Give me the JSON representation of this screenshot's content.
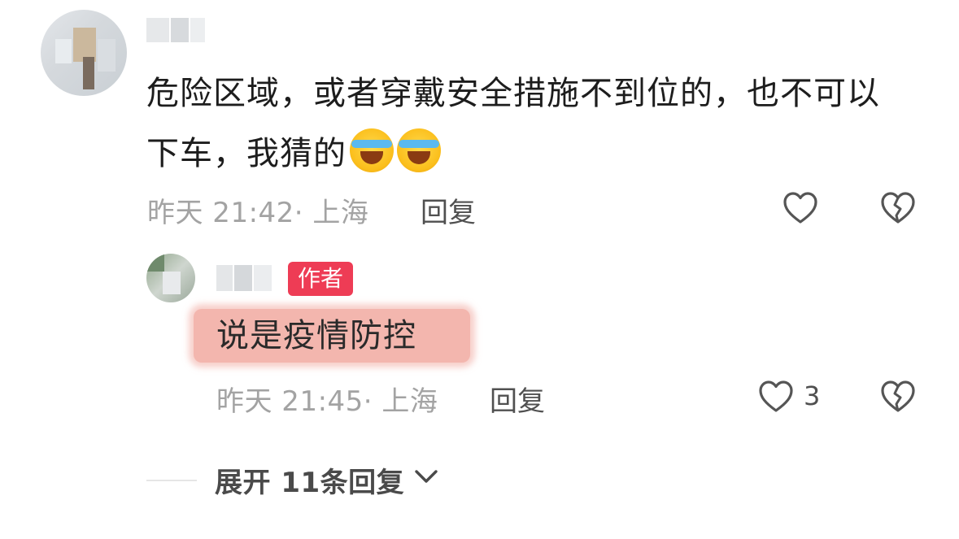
{
  "comment": {
    "text": "危险区域，或者穿戴安全措施不到位的，也不可以下车，我猜的",
    "emojis": [
      "laughing-crying-emoji",
      "laughing-crying-emoji"
    ],
    "time_location": "昨天 21:42· 上海",
    "reply_label": "回复",
    "icons": [
      "heart-icon",
      "broken-heart-icon"
    ]
  },
  "reply": {
    "author_badge": "作者",
    "text": "说是疫情防控",
    "time_location": "昨天 21:45· 上海",
    "reply_label": "回复",
    "like_count": "3",
    "icons": [
      "heart-icon",
      "broken-heart-icon"
    ]
  },
  "expand": {
    "label": "展开 11条回复",
    "icon": "chevron-down-icon"
  },
  "colors": {
    "badge": "#ee3c55",
    "highlight": "#f3b6ae",
    "meta_gray": "#a3a3a3"
  }
}
